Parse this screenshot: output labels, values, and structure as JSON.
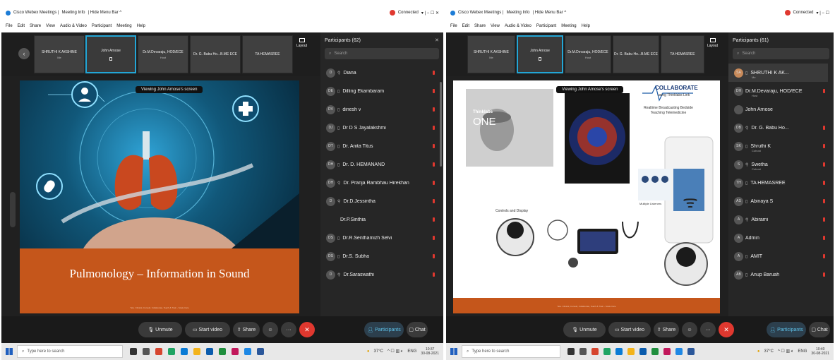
{
  "left": {
    "titlebar": {
      "app": "Cisco Webex Meetings |",
      "meeting_info": "Meeting Info",
      "menu": "| Hide Menu Bar ^",
      "status": "Connected",
      "win_controls": "▾  |  −  ☐  ✕"
    },
    "menu": [
      "File",
      "Edit",
      "Share",
      "View",
      "Audio & Video",
      "Participant",
      "Meeting",
      "Help"
    ],
    "tiles": [
      {
        "name": "SHRUTHI K AKSHINE",
        "sub": "Me"
      },
      {
        "name": "John Arnose",
        "sub": "",
        "active": true
      },
      {
        "name": "Dr.M.Devaraju, HOD/ECE",
        "sub": "Host"
      },
      {
        "name": "Dr. G. Babu Ho...B.ME ECE",
        "sub": ""
      },
      {
        "name": "TA HEMASREE",
        "sub": ""
      }
    ],
    "layout_label": "Layout",
    "viewing": "Viewing John Amose's screen",
    "slide_title": "Pulmonology – Information in Sound",
    "slide_footer": "Tele. Clinical, Consult, Collaborate, Teach & Train - Scale Care",
    "panel_title": "Participants (62)",
    "search_placeholder": "Search",
    "participants": [
      {
        "initials": "D",
        "name": "Diana",
        "sub": ""
      },
      {
        "initials": "DE",
        "name": "Dilling Ekambaram",
        "sub": ""
      },
      {
        "initials": "DV",
        "name": "dinesh v",
        "sub": ""
      },
      {
        "initials": "DJ",
        "name": "Dr D S Jayalakshmi",
        "sub": ""
      },
      {
        "initials": "DT",
        "name": "Dr. Anita Titus",
        "sub": ""
      },
      {
        "initials": "DH",
        "name": "Dr. D. HEMANAND",
        "sub": ""
      },
      {
        "initials": "DH",
        "name": "Dr. Pranja Rambhau Hirekhan",
        "sub": ""
      },
      {
        "initials": "D",
        "name": "Dr.D.Jessintha",
        "sub": ""
      },
      {
        "initials": "",
        "name": "Dr.P.Sinthia",
        "sub": ""
      },
      {
        "initials": "DS",
        "name": "Dr.R.Senthamizh Selvi",
        "sub": ""
      },
      {
        "initials": "DS",
        "name": "Dr.S. Subha",
        "sub": ""
      },
      {
        "initials": "D",
        "name": "Dr.Saraswathi",
        "sub": ""
      }
    ],
    "controls": {
      "unmute": "Unmute",
      "start_video": "Start video",
      "share": "Share",
      "participants": "Participants",
      "chat": "Chat"
    },
    "taskbar": {
      "search": "Type here to search",
      "weather": "37°C",
      "lang": "ENG",
      "time": "10:37",
      "date": "30-08-2021"
    }
  },
  "right": {
    "titlebar": {
      "app": "Cisco Webex Meetings |",
      "meeting_info": "Meeting Info",
      "menu": "| Hide Menu Bar ^",
      "status": "Connected",
      "win_controls": "▾  |  −  ☐"
    },
    "menu": [
      "File",
      "Edit",
      "Share",
      "View",
      "Audio & Video",
      "Participant",
      "Meeting",
      "Help"
    ],
    "tiles": [
      {
        "name": "SHRUTHI K AKSHINE",
        "sub": "Me"
      },
      {
        "name": "John Arnose",
        "sub": "",
        "active": true
      },
      {
        "name": "Dr.M.Devaraju, HOD/ECE",
        "sub": "Host"
      },
      {
        "name": "Dr. G. Babu Ho...B.ME ECE",
        "sub": ""
      },
      {
        "name": "TA HEMASREE",
        "sub": ""
      }
    ],
    "layout_label": "Layout",
    "viewing": "Viewing John Amose's screen",
    "brand_word": "ONE",
    "brand_small": "Thinklabs",
    "collab_title": "COLLABORATE",
    "collab_using": "using Thinklabs Link",
    "collab_desc": "Realtime Broadcasting Bedside Teaching Telemedicine",
    "multiple_listeners": "Multiple Listeners",
    "controls_display": "Controls and Display",
    "slide_footer": "Tele. Clinical, Consult, Collaborate, Teach & Train - Scale Care",
    "panel_title": "Participants (61)",
    "search_placeholder": "Search",
    "participants": [
      {
        "initials": "SA",
        "name": "SHRUTHI K AK...",
        "sub": "Me"
      },
      {
        "initials": "DH",
        "name": "Dr.M.Devaraju, HOD/ECE",
        "sub": "Host"
      },
      {
        "initials": "",
        "name": "John Arnose",
        "sub": ""
      },
      {
        "initials": "DB",
        "name": "Dr. G. Babu Ho...",
        "sub": ""
      },
      {
        "initials": "SK",
        "name": "Shruthi K",
        "sub": "Cohost"
      },
      {
        "initials": "S",
        "name": "Swetha",
        "sub": "Cohost"
      },
      {
        "initials": "TH",
        "name": "TA HEMASREE",
        "sub": ""
      },
      {
        "initials": "AS",
        "name": "Abinaya S",
        "sub": ""
      },
      {
        "initials": "A",
        "name": "Abirami",
        "sub": ""
      },
      {
        "initials": "A",
        "name": "Admin",
        "sub": ""
      },
      {
        "initials": "A",
        "name": "AMIT",
        "sub": ""
      },
      {
        "initials": "AB",
        "name": "Anup Baruah",
        "sub": ""
      }
    ],
    "controls": {
      "unmute": "Unmute",
      "start_video": "Start video",
      "share": "Share",
      "participants": "Participants",
      "chat": "Chat"
    },
    "taskbar": {
      "search": "Type here to search",
      "weather": "37°C",
      "lang": "ENG",
      "time": "10:40",
      "date": "30-08-2021"
    }
  }
}
